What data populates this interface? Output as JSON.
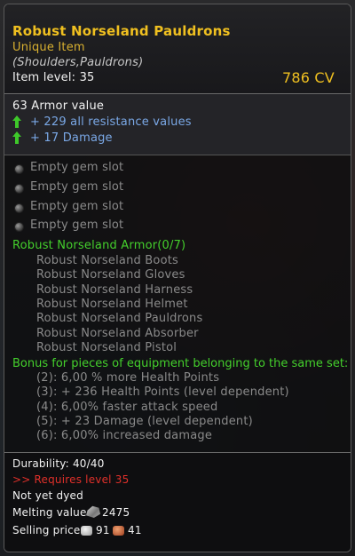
{
  "item": {
    "name": "Robust Norseland Pauldrons",
    "rarity": "Unique Item",
    "category": "(Shoulders,Pauldrons)",
    "level_label": "Item level:",
    "level": "35",
    "cv": "786 CV"
  },
  "stats": {
    "armor": "63 Armor value",
    "bonus": [
      "+ 229 all resistance values",
      "+ 17 Damage"
    ]
  },
  "gems": [
    "Empty gem slot",
    "Empty gem slot",
    "Empty gem slot",
    "Empty gem slot"
  ],
  "set": {
    "title": "Robust Norseland Armor(0/7)",
    "pieces": [
      "Robust Norseland Boots",
      "Robust Norseland Gloves",
      "Robust Norseland Harness",
      "Robust Norseland Helmet",
      "Robust Norseland Pauldrons",
      "Robust Norseland Absorber",
      "Robust Norseland Pistol"
    ],
    "bonus_title": "Bonus for pieces of equipment belonging to the same set:",
    "bonuses": [
      "(2): 6,00 % more Health Points",
      "(3): + 236 Health Points (level dependent)",
      "(4): 6,00% faster attack speed",
      "(5): + 23 Damage (level dependent)",
      "(6): 6,00% increased damage"
    ]
  },
  "footer": {
    "durability": "Durability: 40/40",
    "requires": ">> Requires level 35",
    "dyed": "Not yet dyed",
    "melting_label": "Melting value:",
    "melting_value": "2475",
    "selling_label": "Selling price:",
    "silver": "91",
    "copper": "41"
  },
  "colors": {
    "title": "#f0c020",
    "set_green": "#44d02c",
    "bonus_blue": "#7aa8e6",
    "requires_red": "#e0302a"
  }
}
